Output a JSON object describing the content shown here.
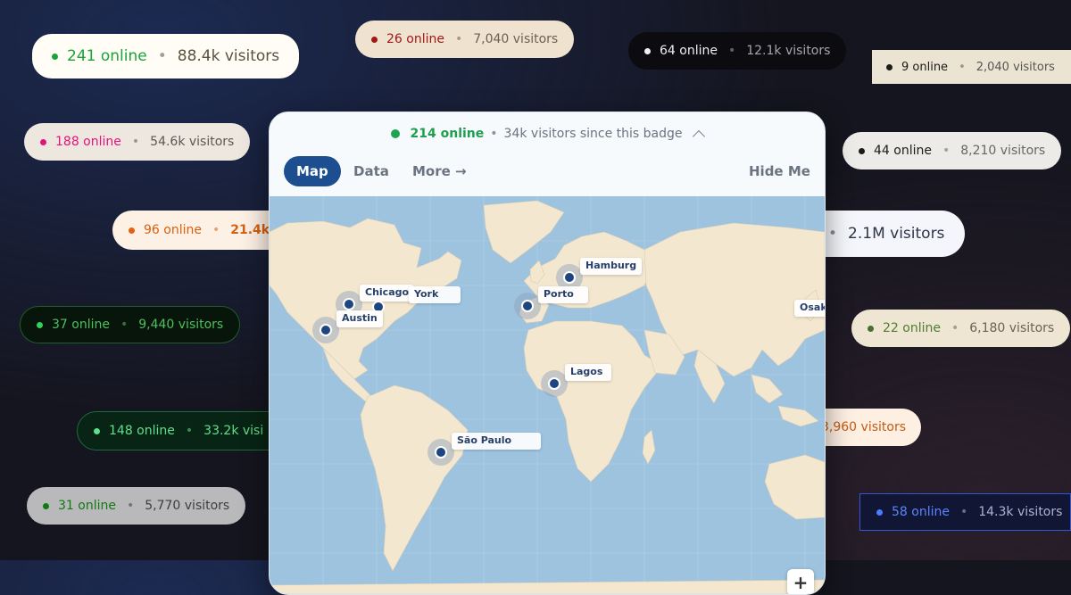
{
  "badges": [
    {
      "online": "241 online",
      "visitors": "88.4k visitors"
    },
    {
      "online": "26 online",
      "visitors": "7,040 visitors"
    },
    {
      "online": "64 online",
      "visitors": "12.1k visitors"
    },
    {
      "online": "9 online",
      "visitors": "2,040 visitors"
    },
    {
      "online": "188 online",
      "visitors": "54.6k visitors"
    },
    {
      "online": "44 online",
      "visitors": "8,210 visitors"
    },
    {
      "online": "96 online",
      "visitors": "21.4k"
    },
    {
      "visitors": "2.1M visitors"
    },
    {
      "online": "37 online",
      "visitors": "9,440 visitors"
    },
    {
      "online": "22 online",
      "visitors": "6,180 visitors"
    },
    {
      "online": "148 online",
      "visitors": "33.2k visi"
    },
    {
      "visitors": "3,960 visitors"
    },
    {
      "online": "31 online",
      "visitors": "5,770 visitors"
    },
    {
      "online": "58 online",
      "visitors": "14.3k visitors"
    }
  ],
  "widget": {
    "online": "214 online",
    "bullet": "•",
    "since": "34k visitors since this badge",
    "tabs": {
      "map": "Map",
      "data": "Data",
      "more": "More →",
      "hide": "Hide Me"
    },
    "zoom_in": "+"
  },
  "cities": [
    "Chicago",
    "York",
    "Austin",
    "Hamburg",
    "Porto",
    "Lagos",
    "São Paulo",
    "Osak"
  ],
  "colors": {
    "online_green": "#1f9e4f",
    "tab_active": "#1d4e8f",
    "map_water": "#9ec3df",
    "map_land": "#f3e7cf",
    "marker": "#1d4580"
  },
  "icons": {
    "status": "green-dot-icon",
    "collapse": "chevron-up-icon",
    "zoom": "plus-icon"
  }
}
